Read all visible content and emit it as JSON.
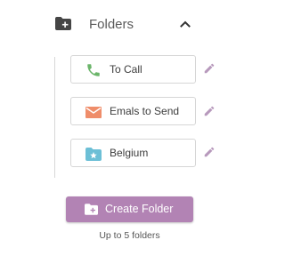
{
  "header": {
    "title": "Folders",
    "icon": "folder-plus-icon",
    "toggle_icon": "chevron-up-icon"
  },
  "folders": [
    {
      "label": "To Call",
      "icon": "phone-icon",
      "icon_color": "#6bb56a"
    },
    {
      "label": "Emals to Send",
      "icon": "mail-icon",
      "icon_color": "#ef8d6a"
    },
    {
      "label": "Belgium",
      "icon": "folder-star-icon",
      "icon_color": "#6cbfd6"
    }
  ],
  "edit_icon": "pencil-icon",
  "create_button": {
    "label": "Create Folder",
    "icon": "folder-plus-icon"
  },
  "limit_note": "Up to 5 folders",
  "colors": {
    "accent": "#b283b4",
    "edit": "#b799bc",
    "border": "#d6d6d6"
  }
}
